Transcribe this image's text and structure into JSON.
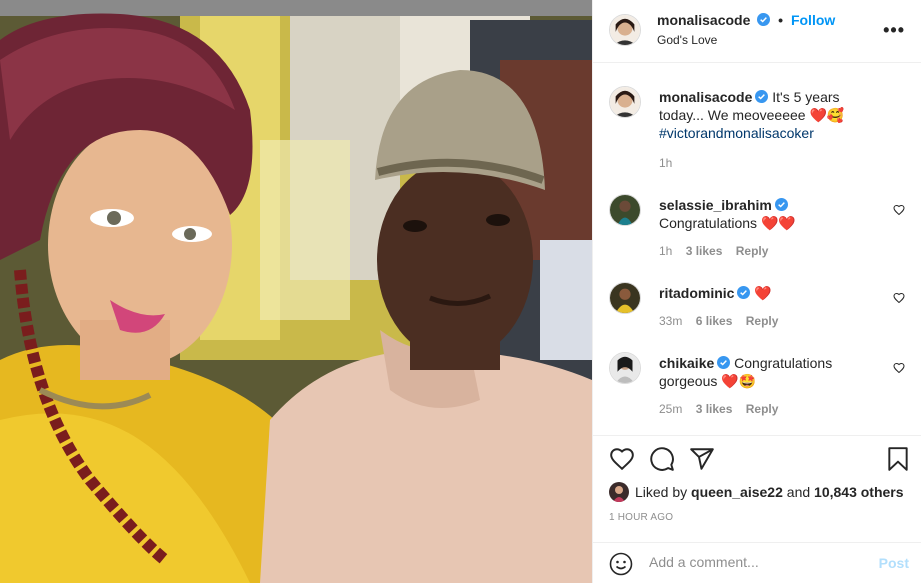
{
  "post": {
    "username": "monalisacode",
    "follow_label": "Follow",
    "dot": "•",
    "location": "God's Love",
    "more_label": "•••"
  },
  "caption": {
    "username": "monalisacode",
    "text": "It's 5 years today... We meoveeeee",
    "emoji": "❤️🥰",
    "hashtag": "#victorandmonalisacoker",
    "time": "1h"
  },
  "comments": [
    {
      "username": "selassie_ibrahim",
      "text": "Congratulations",
      "emoji": "❤️❤️",
      "time": "1h",
      "likes": "3 likes",
      "reply": "Reply"
    },
    {
      "username": "ritadominic",
      "text": "",
      "emoji": "❤️",
      "time": "33m",
      "likes": "6 likes",
      "reply": "Reply"
    },
    {
      "username": "chikaike",
      "text": "Congratulations gorgeous",
      "emoji": "❤️🤩",
      "time": "25m",
      "likes": "3 likes",
      "reply": "Reply"
    }
  ],
  "likes": {
    "prefix": "Liked by",
    "user": "queen_aise22",
    "conj": "and",
    "others": "10,843 others"
  },
  "timestamp": "1 HOUR AGO",
  "add_comment": {
    "placeholder": "Add a comment...",
    "post_label": "Post"
  },
  "colors": {
    "accent": "#0095f6",
    "verified": "#3897f0",
    "heart": "#ed4956",
    "post_disabled": "#b2dffc"
  },
  "icons": [
    "heart-icon",
    "comment-icon",
    "share-icon",
    "bookmark-icon",
    "smile-icon",
    "verified-icon",
    "more-icon"
  ]
}
